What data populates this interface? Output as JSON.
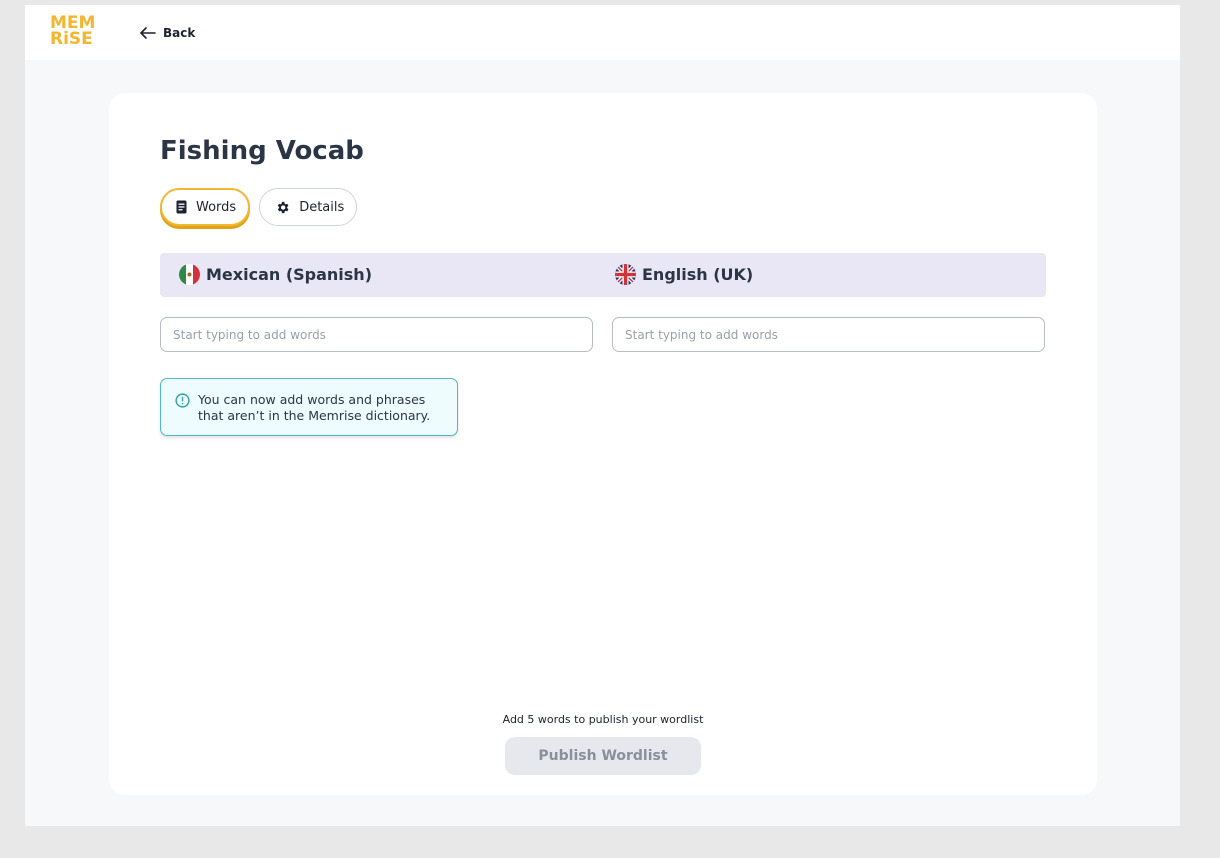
{
  "brand": {
    "logo_line1": "MEM",
    "logo_line2": "RiSE",
    "accent": "#f2b631"
  },
  "header": {
    "back_label": "Back"
  },
  "page": {
    "title": "Fishing Vocab"
  },
  "tabs": [
    {
      "label": "Words",
      "icon": "document-icon",
      "active": true
    },
    {
      "label": "Details",
      "icon": "gear-icon",
      "active": false
    }
  ],
  "languages": {
    "source": {
      "label": "Mexican (Spanish)",
      "flag": "mexico-flag-icon"
    },
    "target": {
      "label": "English (UK)",
      "flag": "uk-flag-icon"
    }
  },
  "inputs": {
    "source_placeholder": "Start typing to add words",
    "target_placeholder": "Start typing to add words",
    "source_value": "",
    "target_value": ""
  },
  "notice": {
    "line1": "You can now add words and phrases",
    "line2": "that aren’t in the Memrise dictionary.",
    "icon": "info-icon"
  },
  "footer": {
    "hint": "Add 5 words to publish your wordlist",
    "publish_label": "Publish Wordlist"
  }
}
